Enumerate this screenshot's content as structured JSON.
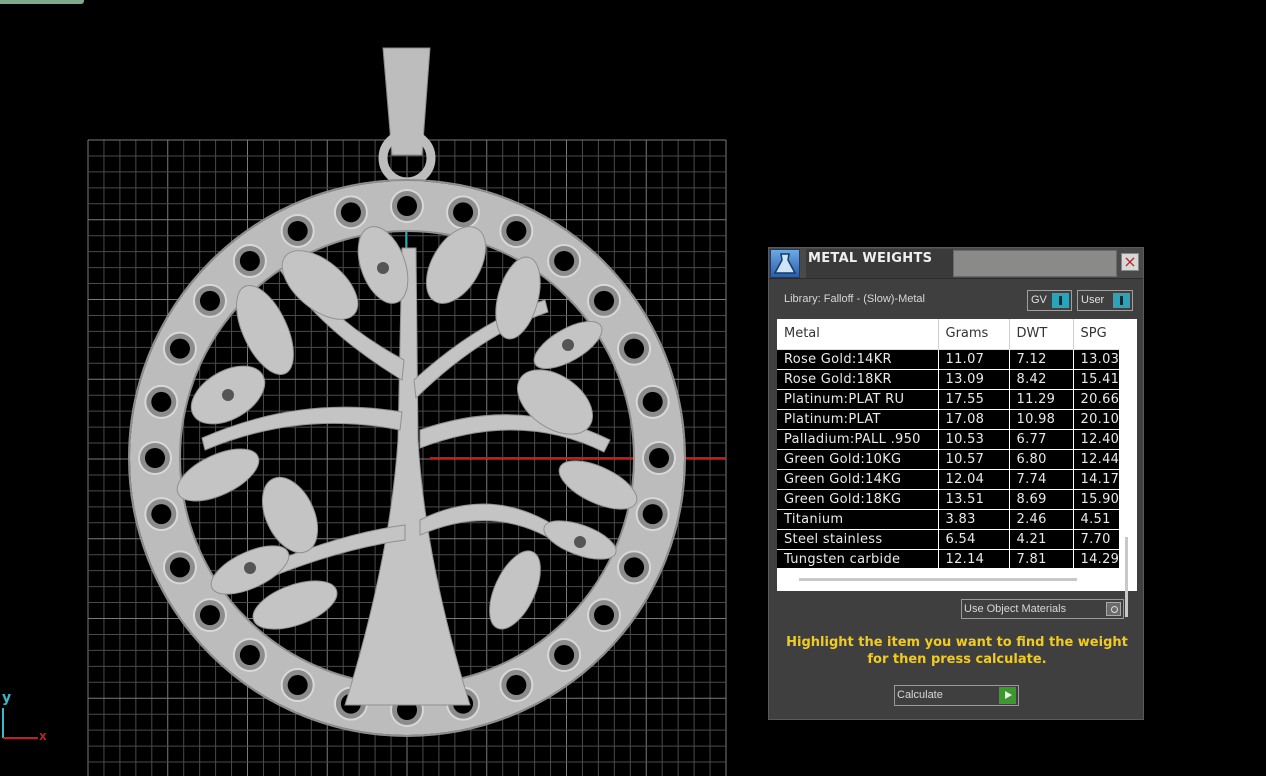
{
  "viewport": {
    "axis_labels": {
      "y": "y",
      "x": "x"
    }
  },
  "panel": {
    "title": "METAL WEIGHTS",
    "close_glyph": "×",
    "library_label": "Library: Falloff - (Slow)-Metal",
    "toggles": {
      "gv_label": "GV",
      "user_label": "User"
    },
    "table": {
      "headers": [
        "Metal",
        "Grams",
        "DWT",
        "SPG"
      ],
      "rows": [
        [
          "Rose Gold:14KR",
          "11.07",
          "7.12",
          "13.03"
        ],
        [
          "Rose Gold:18KR",
          "13.09",
          "8.42",
          "15.41"
        ],
        [
          "Platinum:PLAT RU",
          "17.55",
          "11.29",
          "20.66"
        ],
        [
          "Platinum:PLAT",
          "17.08",
          "10.98",
          "20.10"
        ],
        [
          "Palladium:PALL .950",
          "10.53",
          "6.77",
          "12.40"
        ],
        [
          "Green Gold:10KG",
          "10.57",
          "6.80",
          "12.44"
        ],
        [
          "Green Gold:14KG",
          "12.04",
          "7.74",
          "14.17"
        ],
        [
          "Green Gold:18KG",
          "13.51",
          "8.69",
          "15.90"
        ],
        [
          "Titanium",
          "3.83",
          "2.46",
          "4.51"
        ],
        [
          "Steel stainless",
          "6.54",
          "4.21",
          "7.70"
        ],
        [
          "Tungsten carbide",
          "12.14",
          "7.81",
          "14.29"
        ]
      ]
    },
    "use_object_materials_label": "Use Object Materials",
    "hint_text": "Highlight the item you want to find the weight for then press calculate.",
    "calculate_label": "Calculate",
    "colors": {
      "hint": "#f2cc1c",
      "toggle_knob": "#2ba3b8",
      "calculate_play": "#3a9a2c"
    }
  }
}
